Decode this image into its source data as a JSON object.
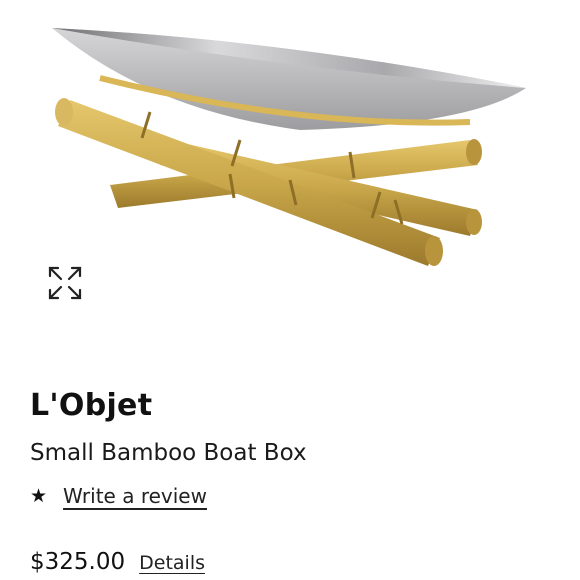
{
  "product": {
    "brand": "L'Objet",
    "name": "Small Bamboo Boat Box",
    "review_label": "Write a review",
    "rating_icon": "star-icon",
    "price": "$325.00",
    "details_label": "Details"
  },
  "image": {
    "expand_icon": "expand-icon",
    "bowl_color": "#b7b7b9",
    "bamboo_color": "#c9a74a"
  }
}
